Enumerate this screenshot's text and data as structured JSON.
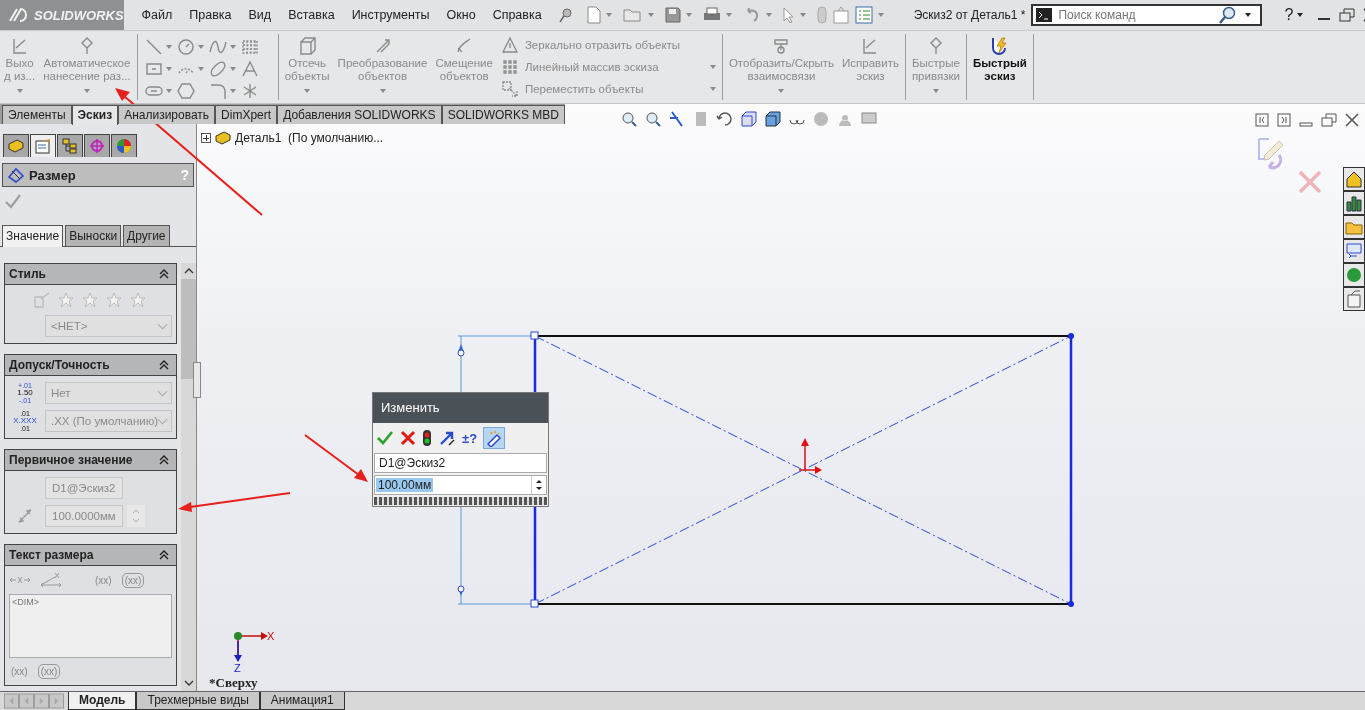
{
  "app": {
    "logo": "SOLIDWORKS"
  },
  "menu": [
    {
      "label": "Файл"
    },
    {
      "label": "Правка"
    },
    {
      "label": "Вид"
    },
    {
      "label": "Вставка"
    },
    {
      "label": "Инструменты"
    },
    {
      "label": "Окно"
    },
    {
      "label": "Справка"
    }
  ],
  "document_title": "Эскиз2 от Деталь1 *",
  "search": {
    "placeholder": "Поиск команд"
  },
  "help": "?",
  "ribbon": [
    {
      "items": [
        {
          "kind": "large",
          "lines": [
            "Выхо",
            "д из..."
          ],
          "disabled": true,
          "dropdown": true
        },
        {
          "kind": "large",
          "lines": [
            "Автоматическое",
            "нанесение раз..."
          ],
          "disabled": true,
          "dropdown": true
        }
      ]
    },
    {
      "items": [
        {
          "kind": "tools"
        }
      ]
    },
    {
      "items": [
        {
          "kind": "large",
          "lines": [
            "Отсечь",
            "объекты"
          ],
          "disabled": true,
          "dropdown": true
        },
        {
          "kind": "large",
          "lines": [
            "Преобразование",
            "объектов"
          ],
          "disabled": true,
          "dropdown": true
        },
        {
          "kind": "large",
          "lines": [
            "Смещение",
            "объектов"
          ],
          "disabled": true,
          "dropdown": false
        },
        {
          "kind": "list",
          "rows": [
            {
              "label": "Зеркально отразить объекты",
              "dropdown": false
            },
            {
              "label": "Линейный массив эскиза",
              "dropdown": true
            },
            {
              "label": "Переместить объекты",
              "dropdown": true
            }
          ]
        }
      ]
    },
    {
      "items": [
        {
          "kind": "large",
          "lines": [
            "Отобразить/Скрыть",
            "взаимосвязи"
          ],
          "disabled": true,
          "dropdown": true
        },
        {
          "kind": "large",
          "lines": [
            "Исправить",
            "эскиз"
          ],
          "disabled": true,
          "dropdown": false
        }
      ]
    },
    {
      "items": [
        {
          "kind": "large",
          "lines": [
            "Быстрые",
            "привязки"
          ],
          "disabled": true,
          "dropdown": true
        }
      ]
    },
    {
      "items": [
        {
          "kind": "large",
          "lines": [
            "Быстрый",
            "эскиз"
          ],
          "disabled": false,
          "dropdown": false
        }
      ]
    }
  ],
  "command_tabs": [
    {
      "label": "Элементы",
      "selected": false
    },
    {
      "label": "Эскиз",
      "selected": true
    },
    {
      "label": "Анализировать",
      "selected": false
    },
    {
      "label": "DimXpert",
      "selected": false
    },
    {
      "label": "Добавления SOLIDWORKS",
      "selected": false
    },
    {
      "label": "SOLIDWORKS MBD",
      "selected": false
    }
  ],
  "property_manager": {
    "manager_tabs": [
      {
        "selected": false
      },
      {
        "selected": true
      },
      {
        "selected": false
      },
      {
        "selected": false
      },
      {
        "selected": false
      }
    ],
    "title": "Размер",
    "help": "?",
    "tabs": [
      {
        "label": "Значение",
        "selected": true
      },
      {
        "label": "Выноски",
        "selected": false
      },
      {
        "label": "Другие",
        "selected": false
      }
    ],
    "sections": [
      {
        "kind": "style",
        "title": "Стиль",
        "dropdown": "<НЕТ>"
      },
      {
        "kind": "tolerance",
        "title": "Допуск/Точность",
        "tolerance": {
          "value": "1.50",
          "upper": "+.01",
          "lower": "-.01",
          "type": "Нет"
        },
        "precision": {
          "format": "X.XXX",
          "upper": ".01",
          "lower": ".01",
          "value": ".XX (По умолчанию)"
        }
      },
      {
        "kind": "primary",
        "title": "Первичное значение",
        "name": "D1@Эскиз2",
        "value": "100.0000мм"
      },
      {
        "kind": "text",
        "title": "Текст размера",
        "text": "<DIM>",
        "buttons": [
          "(xx)",
          "(xx)"
        ],
        "buttons2": [
          "(xx)",
          "(xx)"
        ]
      }
    ]
  },
  "feature_tree": {
    "root": "Деталь1  (По умолчанию..."
  },
  "modify_dialog": {
    "title": "Изменить",
    "tool_label": "±?",
    "name": "D1@Эскиз2",
    "value": "100.00мм",
    "value_selected": true
  },
  "view": {
    "orientation": "*Сверху",
    "axes": [
      "X",
      "Z"
    ]
  },
  "bottom_tabs": [
    {
      "label": "Модель",
      "selected": true
    },
    {
      "label": "Трехмерные виды",
      "selected": false
    },
    {
      "label": "Анимация1",
      "selected": false
    }
  ]
}
